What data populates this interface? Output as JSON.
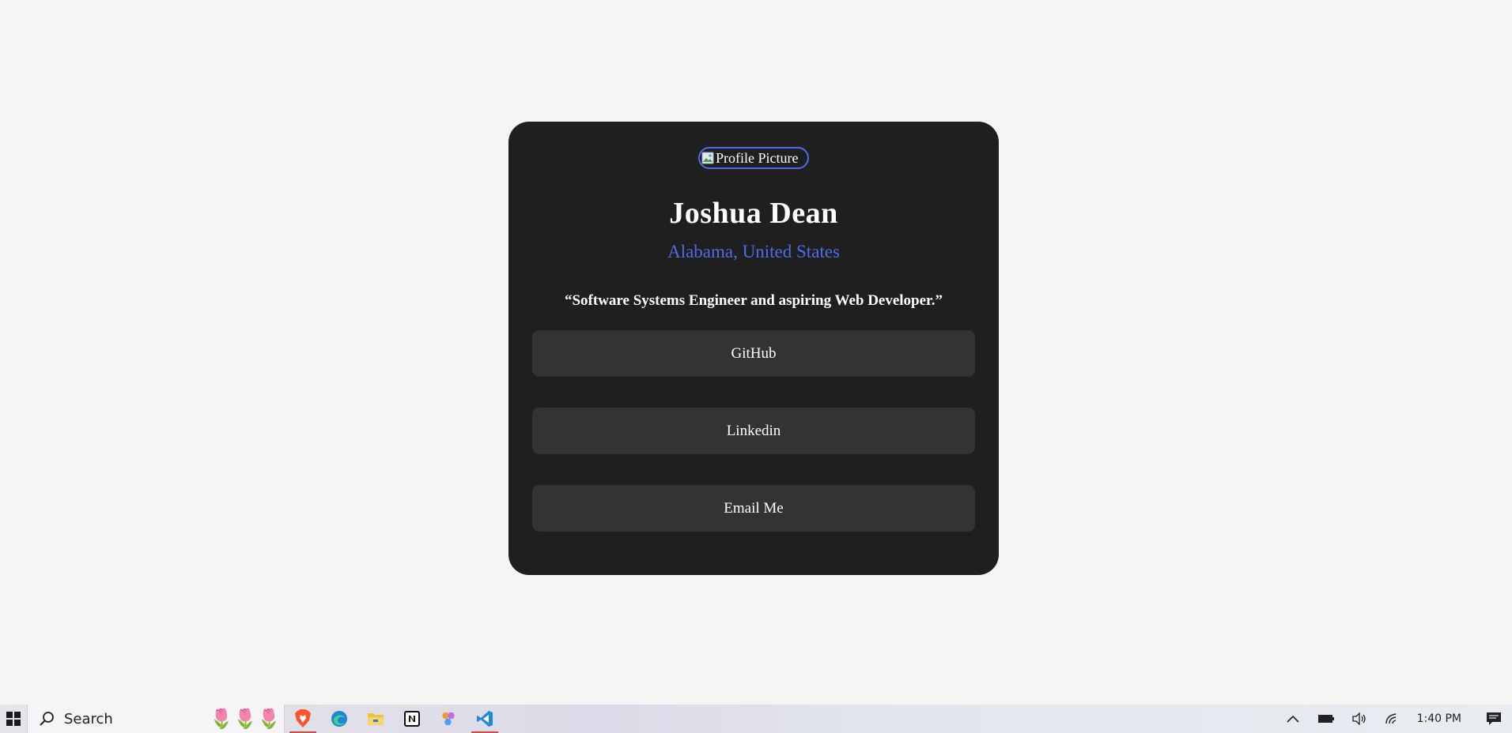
{
  "profile": {
    "avatar_alt": "Profile Picture",
    "name": "Joshua Dean",
    "location": "Alabama, United States",
    "tagline": "“Software Systems Engineer and aspiring Web Developer.”"
  },
  "links": [
    {
      "label": "GitHub"
    },
    {
      "label": "Linkedin"
    },
    {
      "label": "Email Me"
    }
  ],
  "taskbar": {
    "search_label": "Search",
    "apps": [
      "brave-icon",
      "edge-icon",
      "file-explorer-icon",
      "notion-icon",
      "app-icon",
      "vscode-icon"
    ],
    "clock": "1:40 PM"
  },
  "colors": {
    "accent": "#4f6ce8",
    "card_bg": "#1f1f1f",
    "button_bg": "#333333",
    "page_bg": "#f4f4f4"
  }
}
